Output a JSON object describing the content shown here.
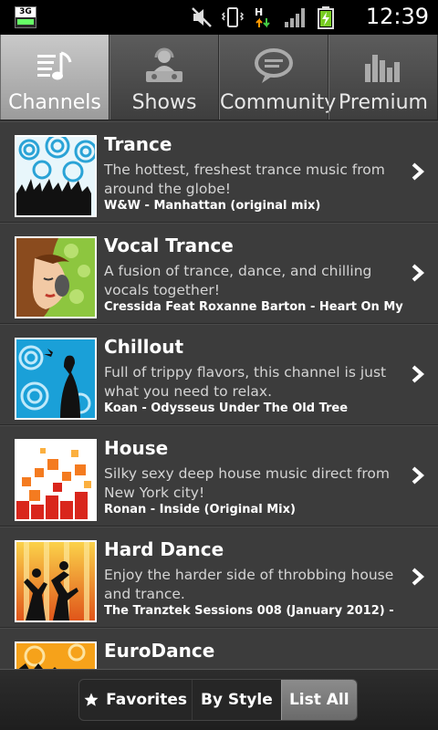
{
  "status_bar": {
    "network_badge": "3G",
    "time": "12:39",
    "data_indicator": "H",
    "icons": [
      "3g-data-icon",
      "muted-icon",
      "vibrate-icon",
      "h-network-icon",
      "signal-icon",
      "battery-charging-icon"
    ]
  },
  "tabs": [
    {
      "label": "Channels",
      "icon": "music-list-icon",
      "active": true
    },
    {
      "label": "Shows",
      "icon": "dj-icon",
      "active": false
    },
    {
      "label": "Community",
      "icon": "chat-bubble-icon",
      "active": false
    },
    {
      "label": "Premium",
      "icon": "equalizer-icon",
      "active": false
    }
  ],
  "channels": [
    {
      "title": "Trance",
      "description": "The hottest, freshest trance music from around the globe!",
      "track": "W&W - Manhattan (original mix)"
    },
    {
      "title": "Vocal Trance",
      "description": "A fusion of trance, dance, and chilling vocals together!",
      "track": "Cressida Feat Roxanne Barton - Heart On My"
    },
    {
      "title": "Chillout",
      "description": "Full of trippy flavors, this channel is just what you need to relax.",
      "track": "Koan - Odysseus Under The Old Tree"
    },
    {
      "title": "House",
      "description": "Silky sexy deep house music direct from New York city!",
      "track": "Ronan - Inside (Original Mix)"
    },
    {
      "title": "Hard Dance",
      "description": "Enjoy the harder side of throbbing house and trance.",
      "track": "The Tranztek Sessions 008 (January 2012) -"
    },
    {
      "title": "EuroDance",
      "description": "",
      "track": ""
    }
  ],
  "bottom_bar": {
    "favorites": "Favorites",
    "by_style": "By Style",
    "list_all": "List All",
    "selected": "List All"
  }
}
